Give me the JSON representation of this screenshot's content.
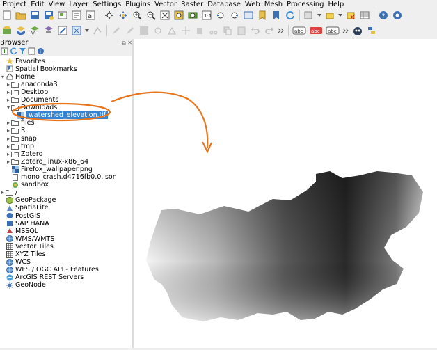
{
  "menu": [
    "Project",
    "Edit",
    "View",
    "Layer",
    "Settings",
    "Plugins",
    "Vector",
    "Raster",
    "Database",
    "Web",
    "Mesh",
    "Processing",
    "Help"
  ],
  "browser": {
    "title": "Browser",
    "items": [
      {
        "label": "Favorites",
        "level": 0,
        "arrow": "",
        "icon": "star-icon"
      },
      {
        "label": "Spatial Bookmarks",
        "level": 0,
        "arrow": "",
        "icon": "bookmark-icon"
      },
      {
        "label": "Home",
        "level": 0,
        "arrow": "▾",
        "icon": "home-folder-icon"
      },
      {
        "label": "anaconda3",
        "level": 1,
        "arrow": "▸",
        "icon": "folder-icon"
      },
      {
        "label": "Desktop",
        "level": 1,
        "arrow": "▸",
        "icon": "folder-icon"
      },
      {
        "label": "Documents",
        "level": 1,
        "arrow": "▸",
        "icon": "folder-icon"
      },
      {
        "label": "Downloads",
        "level": 1,
        "arrow": "▾",
        "icon": "folder-icon"
      },
      {
        "label": "watershed_elevation.tif",
        "level": 2,
        "arrow": "",
        "icon": "raster-icon",
        "selected": true
      },
      {
        "label": "files",
        "level": 1,
        "arrow": "▸",
        "icon": "folder-icon"
      },
      {
        "label": "R",
        "level": 1,
        "arrow": "▸",
        "icon": "folder-icon"
      },
      {
        "label": "snap",
        "level": 1,
        "arrow": "▸",
        "icon": "folder-icon"
      },
      {
        "label": "tmp",
        "level": 1,
        "arrow": "▸",
        "icon": "folder-icon"
      },
      {
        "label": "Zotero",
        "level": 1,
        "arrow": "▸",
        "icon": "folder-icon"
      },
      {
        "label": "Zotero_linux-x86_64",
        "level": 1,
        "arrow": "▸",
        "icon": "folder-icon"
      },
      {
        "label": "Firefox_wallpaper.png",
        "level": 1,
        "arrow": "",
        "icon": "raster-icon"
      },
      {
        "label": "mono_crash.d4716fb0.0.json",
        "level": 1,
        "arrow": "",
        "icon": "file-icon"
      },
      {
        "label": "sandbox",
        "level": 1,
        "arrow": "",
        "icon": "qgis-icon"
      },
      {
        "label": "/",
        "level": 0,
        "arrow": "▸",
        "icon": "folder-icon"
      },
      {
        "label": "GeoPackage",
        "level": 0,
        "arrow": "",
        "icon": "geopackage-icon"
      },
      {
        "label": "SpatiaLite",
        "level": 0,
        "arrow": "",
        "icon": "spatialite-icon"
      },
      {
        "label": "PostGIS",
        "level": 0,
        "arrow": "",
        "icon": "postgis-icon"
      },
      {
        "label": "SAP HANA",
        "level": 0,
        "arrow": "",
        "icon": "database-icon"
      },
      {
        "label": "MSSQL",
        "level": 0,
        "arrow": "",
        "icon": "mssql-icon"
      },
      {
        "label": "WMS/WMTS",
        "level": 0,
        "arrow": "",
        "icon": "globe-icon"
      },
      {
        "label": "Vector Tiles",
        "level": 0,
        "arrow": "",
        "icon": "grid-icon"
      },
      {
        "label": "XYZ Tiles",
        "level": 0,
        "arrow": "",
        "icon": "grid-icon"
      },
      {
        "label": "WCS",
        "level": 0,
        "arrow": "",
        "icon": "globe-icon"
      },
      {
        "label": "WFS / OGC API - Features",
        "level": 0,
        "arrow": "",
        "icon": "globe-icon"
      },
      {
        "label": "ArcGIS REST Servers",
        "level": 0,
        "arrow": "",
        "icon": "arcgis-icon"
      },
      {
        "label": "GeoNode",
        "level": 0,
        "arrow": "",
        "icon": "geonode-icon"
      }
    ]
  },
  "colors": {
    "accent": "#3584d4",
    "annotation": "#e8741c",
    "panel": "#efefef"
  }
}
